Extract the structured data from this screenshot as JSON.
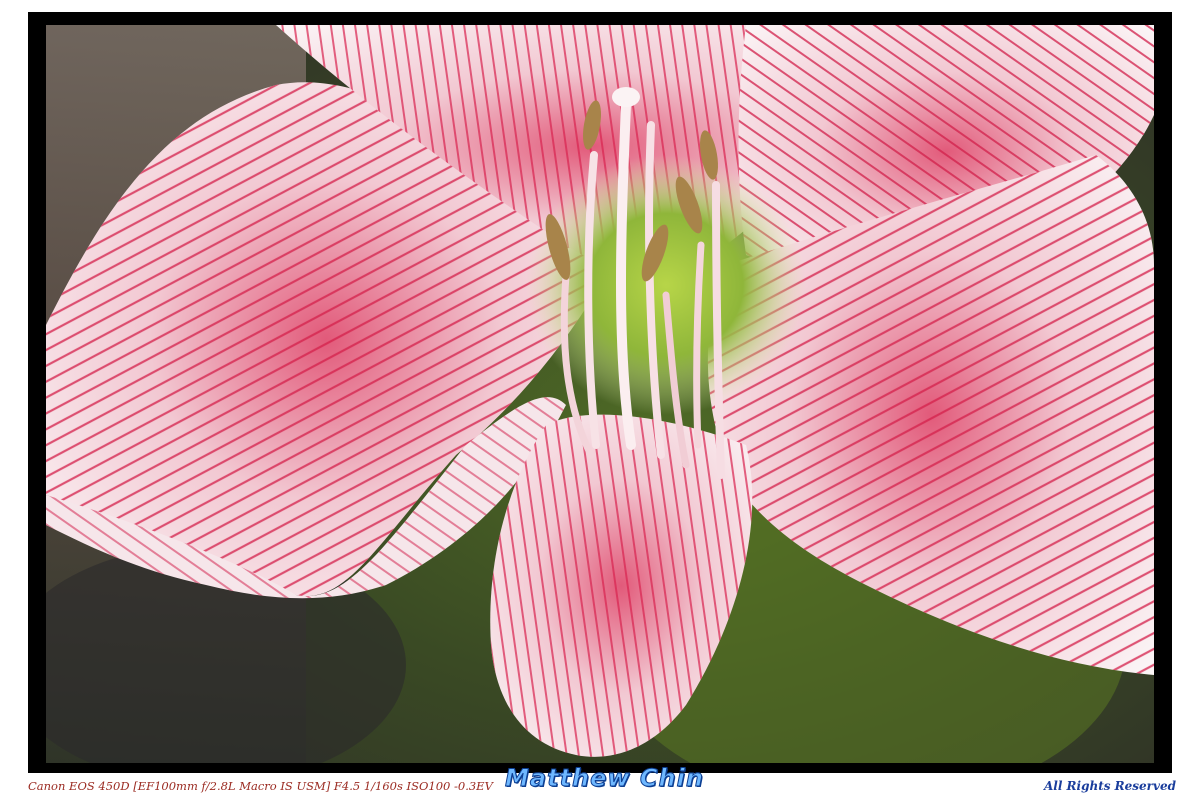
{
  "photo": {
    "subject": "amaryllis-flower",
    "colors": {
      "petal_white": "#f7f2f3",
      "vein_red": "#d21f4a",
      "throat_green": "#9bc43b",
      "background_dark": "#2e3a1f"
    }
  },
  "caption": {
    "exif_text": "Canon EOS 450D [EF100mm f/2.8L Macro IS USM] F4.5 1/160s ISO100 -0.3EV",
    "author": "Matthew Chin",
    "rights": "All Rights Reserved"
  }
}
